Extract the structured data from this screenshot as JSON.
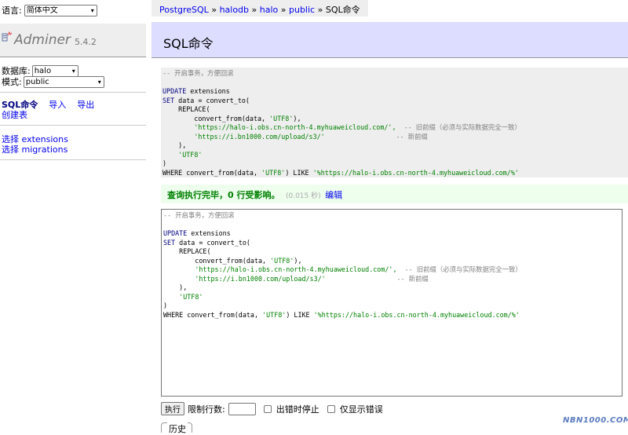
{
  "sidebar": {
    "language_label": "语言:",
    "language_value": "简体中文",
    "logo_text": "Adminer",
    "version": "5.4.2",
    "database_label": "数据库:",
    "database_value": "halo",
    "schema_label": "模式:",
    "schema_value": "public",
    "actions": {
      "sql": "SQL命令",
      "import": "导入",
      "export": "导出",
      "create_table": "创建表"
    },
    "tables": [
      {
        "prefix": "选择",
        "name": "extensions"
      },
      {
        "prefix": "选择",
        "name": "migrations"
      }
    ]
  },
  "breadcrumb": {
    "items": [
      "PostgreSQL",
      "halodb",
      "halo",
      "public"
    ],
    "separator": "»",
    "current": "SQL命令"
  },
  "page": {
    "title": "SQL命令"
  },
  "query": {
    "comment": "-- 开启事务，方便回滚",
    "line_update_kw": "UPDATE",
    "line_update_rest": " extensions",
    "line_set_kw": "SET",
    "line_set_rest": " data = convert_to(",
    "line_replace": "    REPLACE(",
    "line_convert_from": "        convert_from(data, ",
    "str_utf8_quoted": "'UTF8'",
    "line_convert_from_end": "),",
    "old_url": "        'https://halo-i.obs.cn-north-4.myhuaweicloud.com/',",
    "old_comment": "  -- 旧前缀（必须与实际数据完全一致）",
    "new_url": "        'https://i.bn1000.com/upload/s3/'",
    "new_comment": "                  -- 新前缀",
    "line_close_replace": "    ),",
    "line_utf8": "    'UTF8'",
    "line_close": ")",
    "line_where_start": "WHERE convert_from(data, ",
    "line_where_mid": ") LIKE ",
    "line_where_str": "'%https://halo-i.obs.cn-north-4.myhuaweicloud.com/%'"
  },
  "message": {
    "text": "查询执行完毕，0 行受影响。",
    "time": "(0.015 秒)",
    "edit_link": "编辑"
  },
  "controls": {
    "execute": "执行",
    "limit_label": "限制行数:",
    "limit_value": "",
    "stop_on_error": "出错时停止",
    "show_only_errors": "仅显示错误",
    "history": "历史"
  },
  "watermark": "NBN1000.COM",
  "colors": {
    "link": "#0000ee",
    "title_bg": "#ddddff",
    "success": "#008000",
    "sql_keyword": "#000080",
    "sql_string": "#008000",
    "sql_comment": "#808080"
  }
}
